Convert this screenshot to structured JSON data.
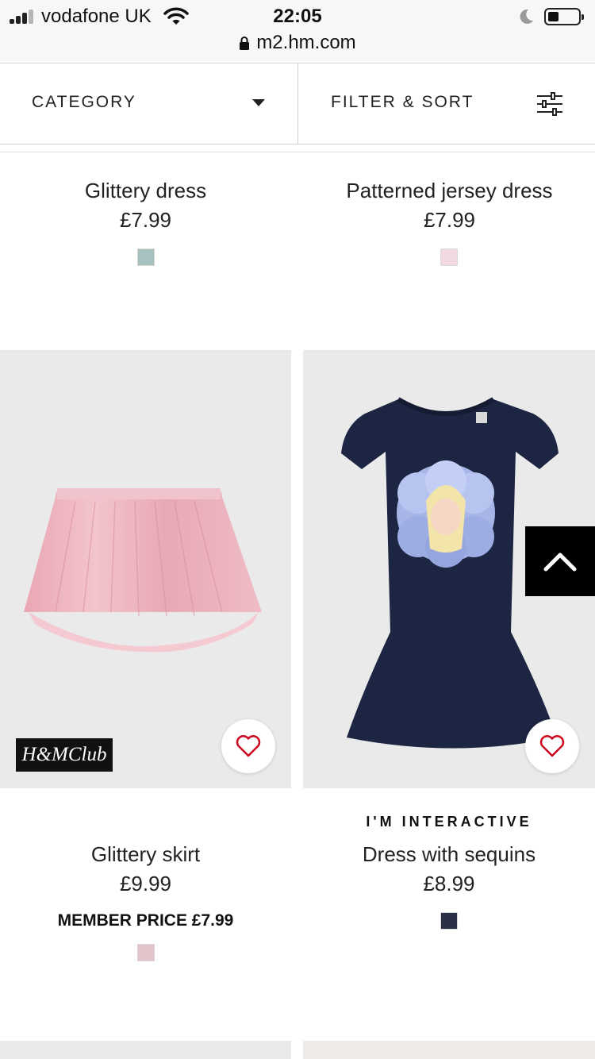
{
  "status_bar": {
    "carrier": "vodafone UK",
    "time": "22:05",
    "url": "m2.hm.com"
  },
  "filters": {
    "category_label": "CATEGORY",
    "filter_sort_label": "FILTER & SORT"
  },
  "products": [
    {
      "name": "Glittery dress",
      "price": "£7.99",
      "swatch_color": "#a7c0c0"
    },
    {
      "name": "Patterned jersey dress",
      "price": "£7.99",
      "swatch_color": "#f1d9e4"
    },
    {
      "name": "Glittery skirt",
      "price": "£9.99",
      "member_price": "MEMBER PRICE £7.99",
      "badge": "H&MClub",
      "swatch_color": "#e2c5cb"
    },
    {
      "name": "Dress with sequins",
      "price": "£8.99",
      "marker": "I'M INTERACTIVE",
      "swatch_color": "#2a3045"
    }
  ],
  "colors": {
    "image_bg": "#ebeaea",
    "skirt_pink": "#eab1bd",
    "dress_navy": "#1c2541",
    "heart_red": "#cc071e"
  }
}
